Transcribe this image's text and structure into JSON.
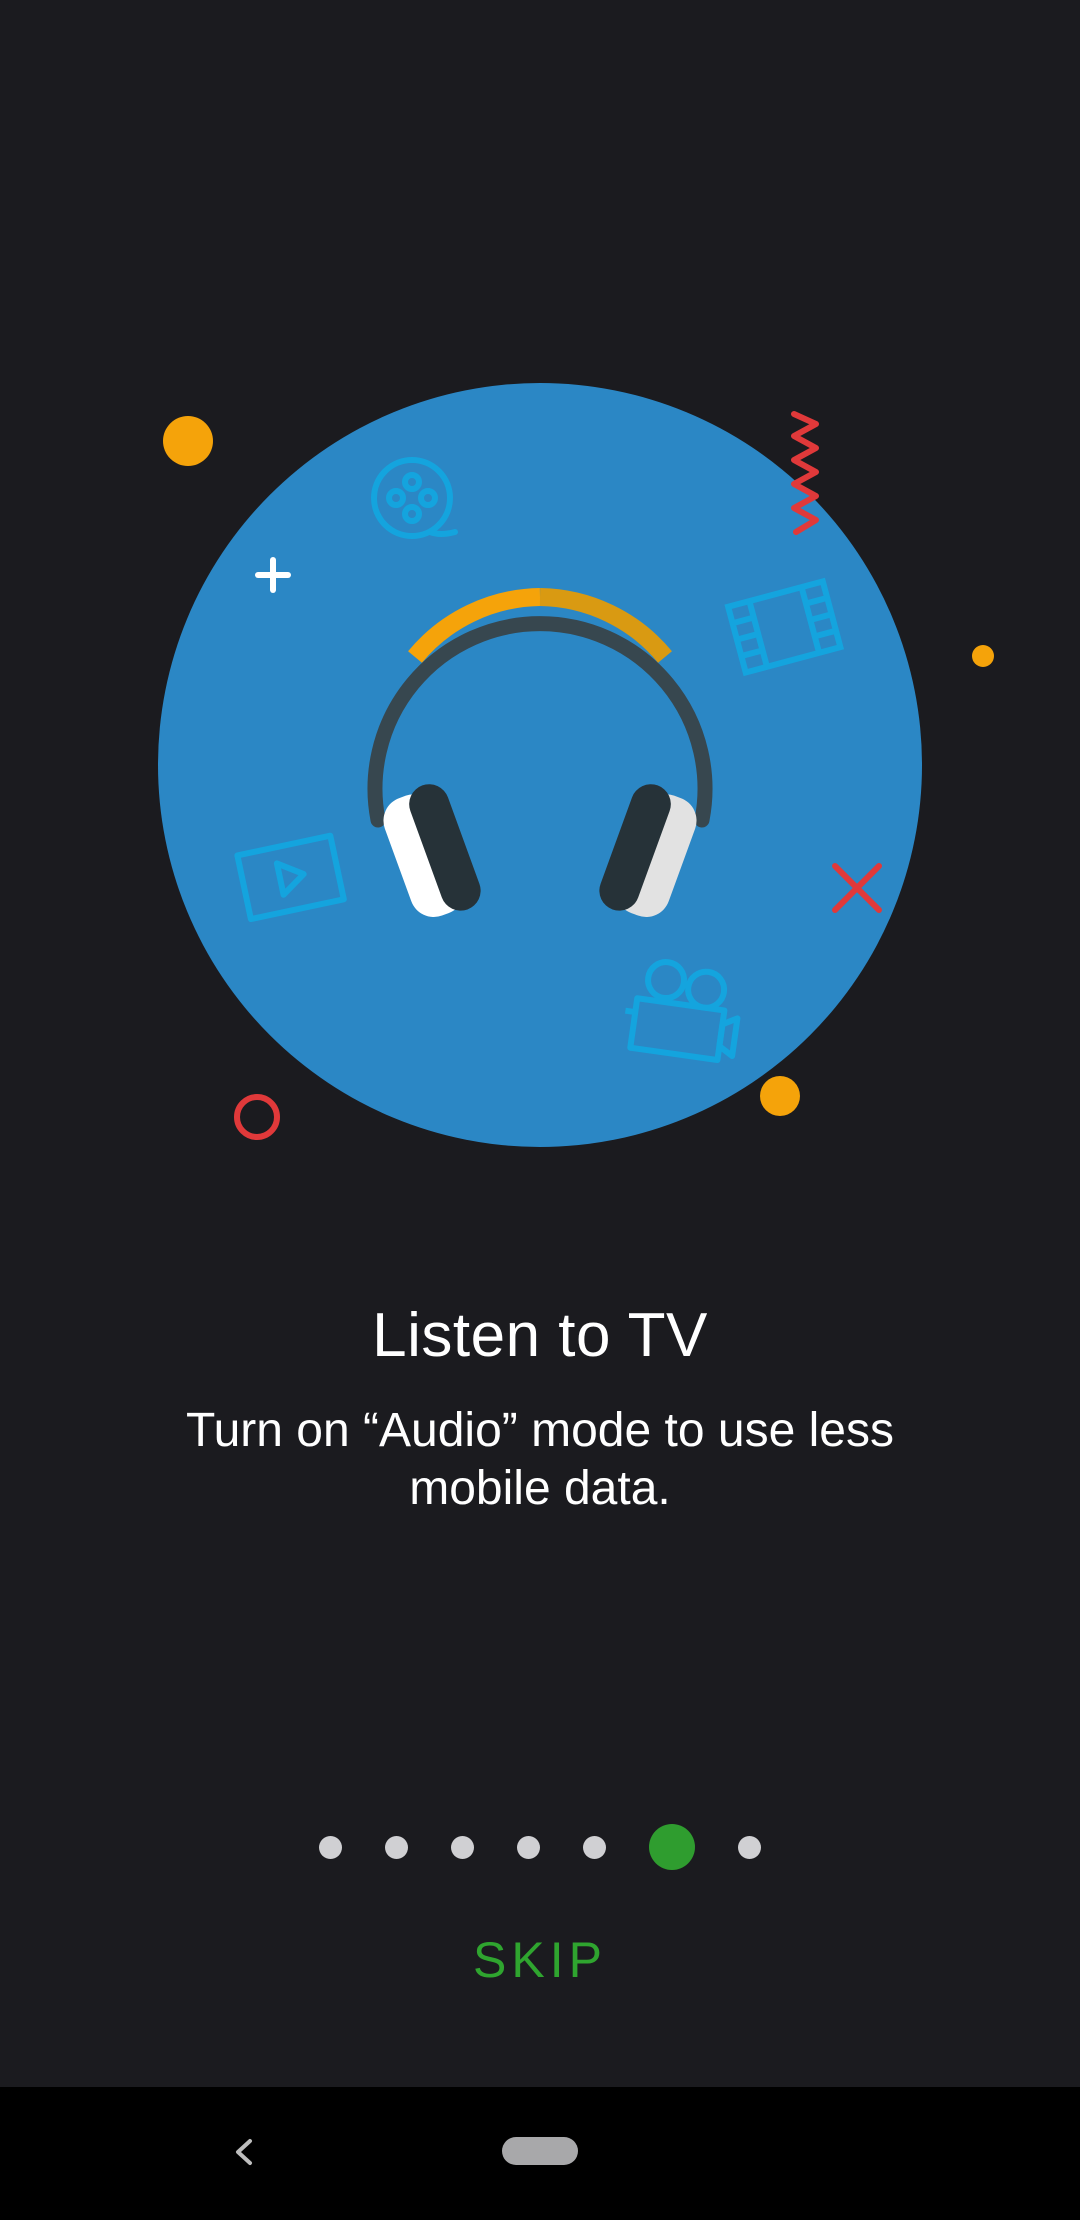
{
  "onboarding": {
    "title": "Listen to TV",
    "description": "Turn on “Audio” mode to use less mobile data.",
    "skip_label": "SKIP",
    "page_indicator": {
      "total_pages": 7,
      "current_page": 6
    }
  },
  "illustration": {
    "subject": "headphones",
    "decorations": [
      "film-reel-icon",
      "film-strip-icon",
      "play-video-icon",
      "movie-camera-icon",
      "plus-icon",
      "close-x-icon",
      "zigzag-icon",
      "ring-icon"
    ]
  },
  "colors": {
    "background": "#1b1b1f",
    "circle": "#2b87c5",
    "accent_green": "#2f9d2f",
    "dot_inactive": "#d0d0d3",
    "orange": "#f5a30a",
    "red": "#e0393a",
    "icon_blue": "#14a4de"
  },
  "system_nav": {
    "back_icon": "chevron-left-icon",
    "home_icon": "home-pill-icon"
  }
}
